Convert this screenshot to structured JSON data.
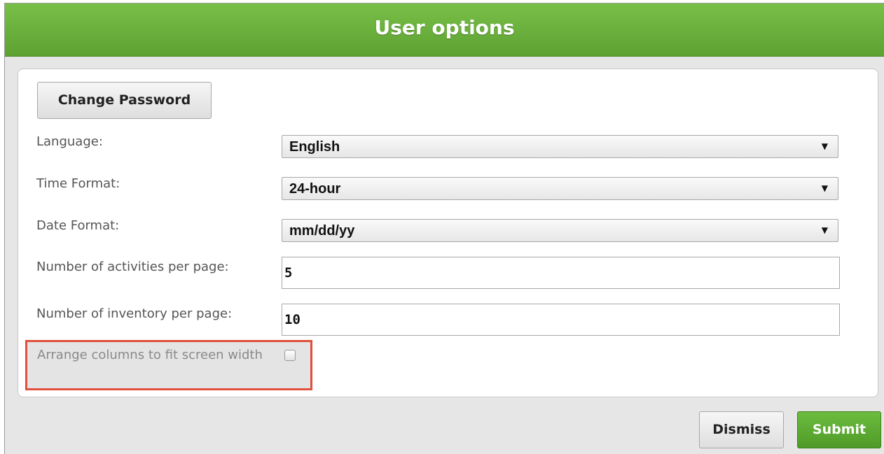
{
  "dialog": {
    "title": "User options"
  },
  "buttons": {
    "change_password": "Change Password",
    "dismiss": "Dismiss",
    "submit": "Submit"
  },
  "fields": {
    "language": {
      "label": "Language:",
      "value": "English"
    },
    "time_format": {
      "label": "Time Format:",
      "value": "24-hour"
    },
    "date_format": {
      "label": "Date Format:",
      "value": "mm/dd/yy"
    },
    "activities_per_page": {
      "label": "Number of activities per page:",
      "value": "5"
    },
    "inventory_per_page": {
      "label": "Number of inventory per page:",
      "value": "10"
    },
    "arrange_columns": {
      "label": "Arrange columns to fit screen width",
      "checked": false
    }
  },
  "icons": {
    "dropdown": "chevron-down-icon"
  },
  "colors": {
    "header_green": "#6ab33a",
    "submit_green": "#5aa52f",
    "highlight_border": "#e0503c"
  }
}
